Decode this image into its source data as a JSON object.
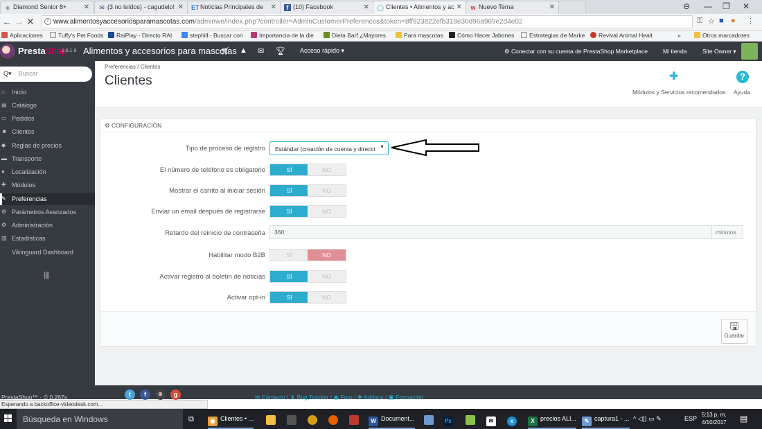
{
  "browser": {
    "tabs": [
      {
        "title": "Diamond Senior 8+",
        "fav": "◈",
        "favColor": "#888"
      },
      {
        "title": "(3 no leídos) - cagudelo!",
        "fav": "✉",
        "favColor": "#5c3c8c"
      },
      {
        "title": "Noticias Principales de",
        "fav": "ET",
        "favColor": "#2a7cc7"
      },
      {
        "title": "(10) Facebook",
        "fav": "f",
        "favColor": "#3b5998"
      },
      {
        "title": "Clientes • Alimentos y ac",
        "fav": "◯",
        "favColor": "#2eacce"
      },
      {
        "title": "Nuevo Tema",
        "fav": "w",
        "favColor": "#c0392b"
      }
    ],
    "url_host": "www.alimentosyaccesoriosparamascotas.com",
    "url_path": "/adminwe/index.php?controller=AdminCustomerPreferences&token=8ff923822efb318e30d96a969e2d4e02",
    "bookmarks": [
      {
        "label": "Aplicaciones",
        "color": "#d9534f"
      },
      {
        "label": "Tuffy's Pet Foods",
        "color": "#ffffff"
      },
      {
        "label": "RaiPlay - Directo RAI",
        "color": "#1a4a9c"
      },
      {
        "label": "stephill - Buscar con",
        "color": "#4285f4"
      },
      {
        "label": "Importancia de la die",
        "color": "#b83a6e"
      },
      {
        "label": "Dieta Barf ¿Mayores",
        "color": "#6b8e23"
      },
      {
        "label": "Para mascotas",
        "color": "#f0c040"
      },
      {
        "label": "Cómo Hacer Jabones",
        "color": "#222222"
      },
      {
        "label": "Estrategias de Marke",
        "color": "#ffffff"
      },
      {
        "label": "Revival Animal Healt",
        "color": "#c0392b"
      }
    ],
    "other_bookmarks": "Otros marcadores"
  },
  "header": {
    "brand_presta": "Presta",
    "brand_shop": "Shop",
    "version": "1.6.1.9",
    "store_name": "Alimentos y accesorios para mascotas",
    "quick_access": "Acceso rápido ▾",
    "connect": "Conectar con su cuenta de PrestaShop Marketplace",
    "my_shop": "Mi tienda",
    "site_owner": "Site Owner ▾"
  },
  "sidebar": {
    "search_placeholder": "Buscar",
    "items": [
      {
        "label": "Inicio",
        "icon": "⌂"
      },
      {
        "label": "Catálogo",
        "icon": "▤"
      },
      {
        "label": "Pedidos",
        "icon": "▭"
      },
      {
        "label": "Clientes",
        "icon": "☻"
      },
      {
        "label": "Reglas de precios",
        "icon": "◆"
      },
      {
        "label": "Transporte",
        "icon": "▬"
      },
      {
        "label": "Localización",
        "icon": "●"
      },
      {
        "label": "Módulos",
        "icon": "✚"
      },
      {
        "label": "Preferencias",
        "icon": "✎"
      },
      {
        "label": "Parámetros Avanzados",
        "icon": "⚙"
      },
      {
        "label": "Administración",
        "icon": "⚙"
      },
      {
        "label": "Estadísticas",
        "icon": "▥"
      },
      {
        "label": "Vikinguard Dashboard",
        "icon": ""
      }
    ]
  },
  "page": {
    "breadcrumb": "Preferencias  /  Clientes",
    "title": "Clientes",
    "modules_label": "Módulos y Servicios recomendados",
    "help_label": "Ayuda"
  },
  "config": {
    "heading": "CONFIGURACIÓN",
    "reg_type_label": "Tipo de proceso de registro",
    "reg_type_value": "Estándar (creación de cuenta y direcci",
    "phone_label": "El número de teléfono es obligatorio",
    "cart_label": "Mostrar el carrito al iniciar sesión",
    "email_label": "Enviar un email después de registrarse",
    "delay_label": "Retardo del reinicio de contraseña",
    "delay_value": "360",
    "delay_unit": "minutos",
    "b2b_label": "Habilitar modo B2B",
    "newsletter_label": "Activar registro al boletín de noticias",
    "optin_label": "Activar opt-in",
    "yes": "SÍ",
    "no": "NO",
    "save": "Guardar"
  },
  "footer": {
    "version": "PrestaShop™ · ⏱ 0.267s",
    "links": "✉ Contacto / ♝ Bug Tracker / ◉ Foro / ✚ Addons / ▣ Formación",
    "status": "Esperando a backoffice-videodesk.com..."
  },
  "taskbar": {
    "search": "Búsqueda en Windows",
    "tasks": [
      {
        "label": "Clientes • ...",
        "icon": "◉",
        "color": "#e8a33d"
      },
      {
        "label": "Document...",
        "icon": "W",
        "color": "#2b579a"
      },
      {
        "label": "precios ALI...",
        "icon": "X",
        "color": "#1e7145"
      },
      {
        "label": "captura1 - ...",
        "icon": "✎",
        "color": "#6f9ad1"
      }
    ],
    "lang": "ESP",
    "time": "5:13 p. m.",
    "date": "4/10/2017"
  }
}
